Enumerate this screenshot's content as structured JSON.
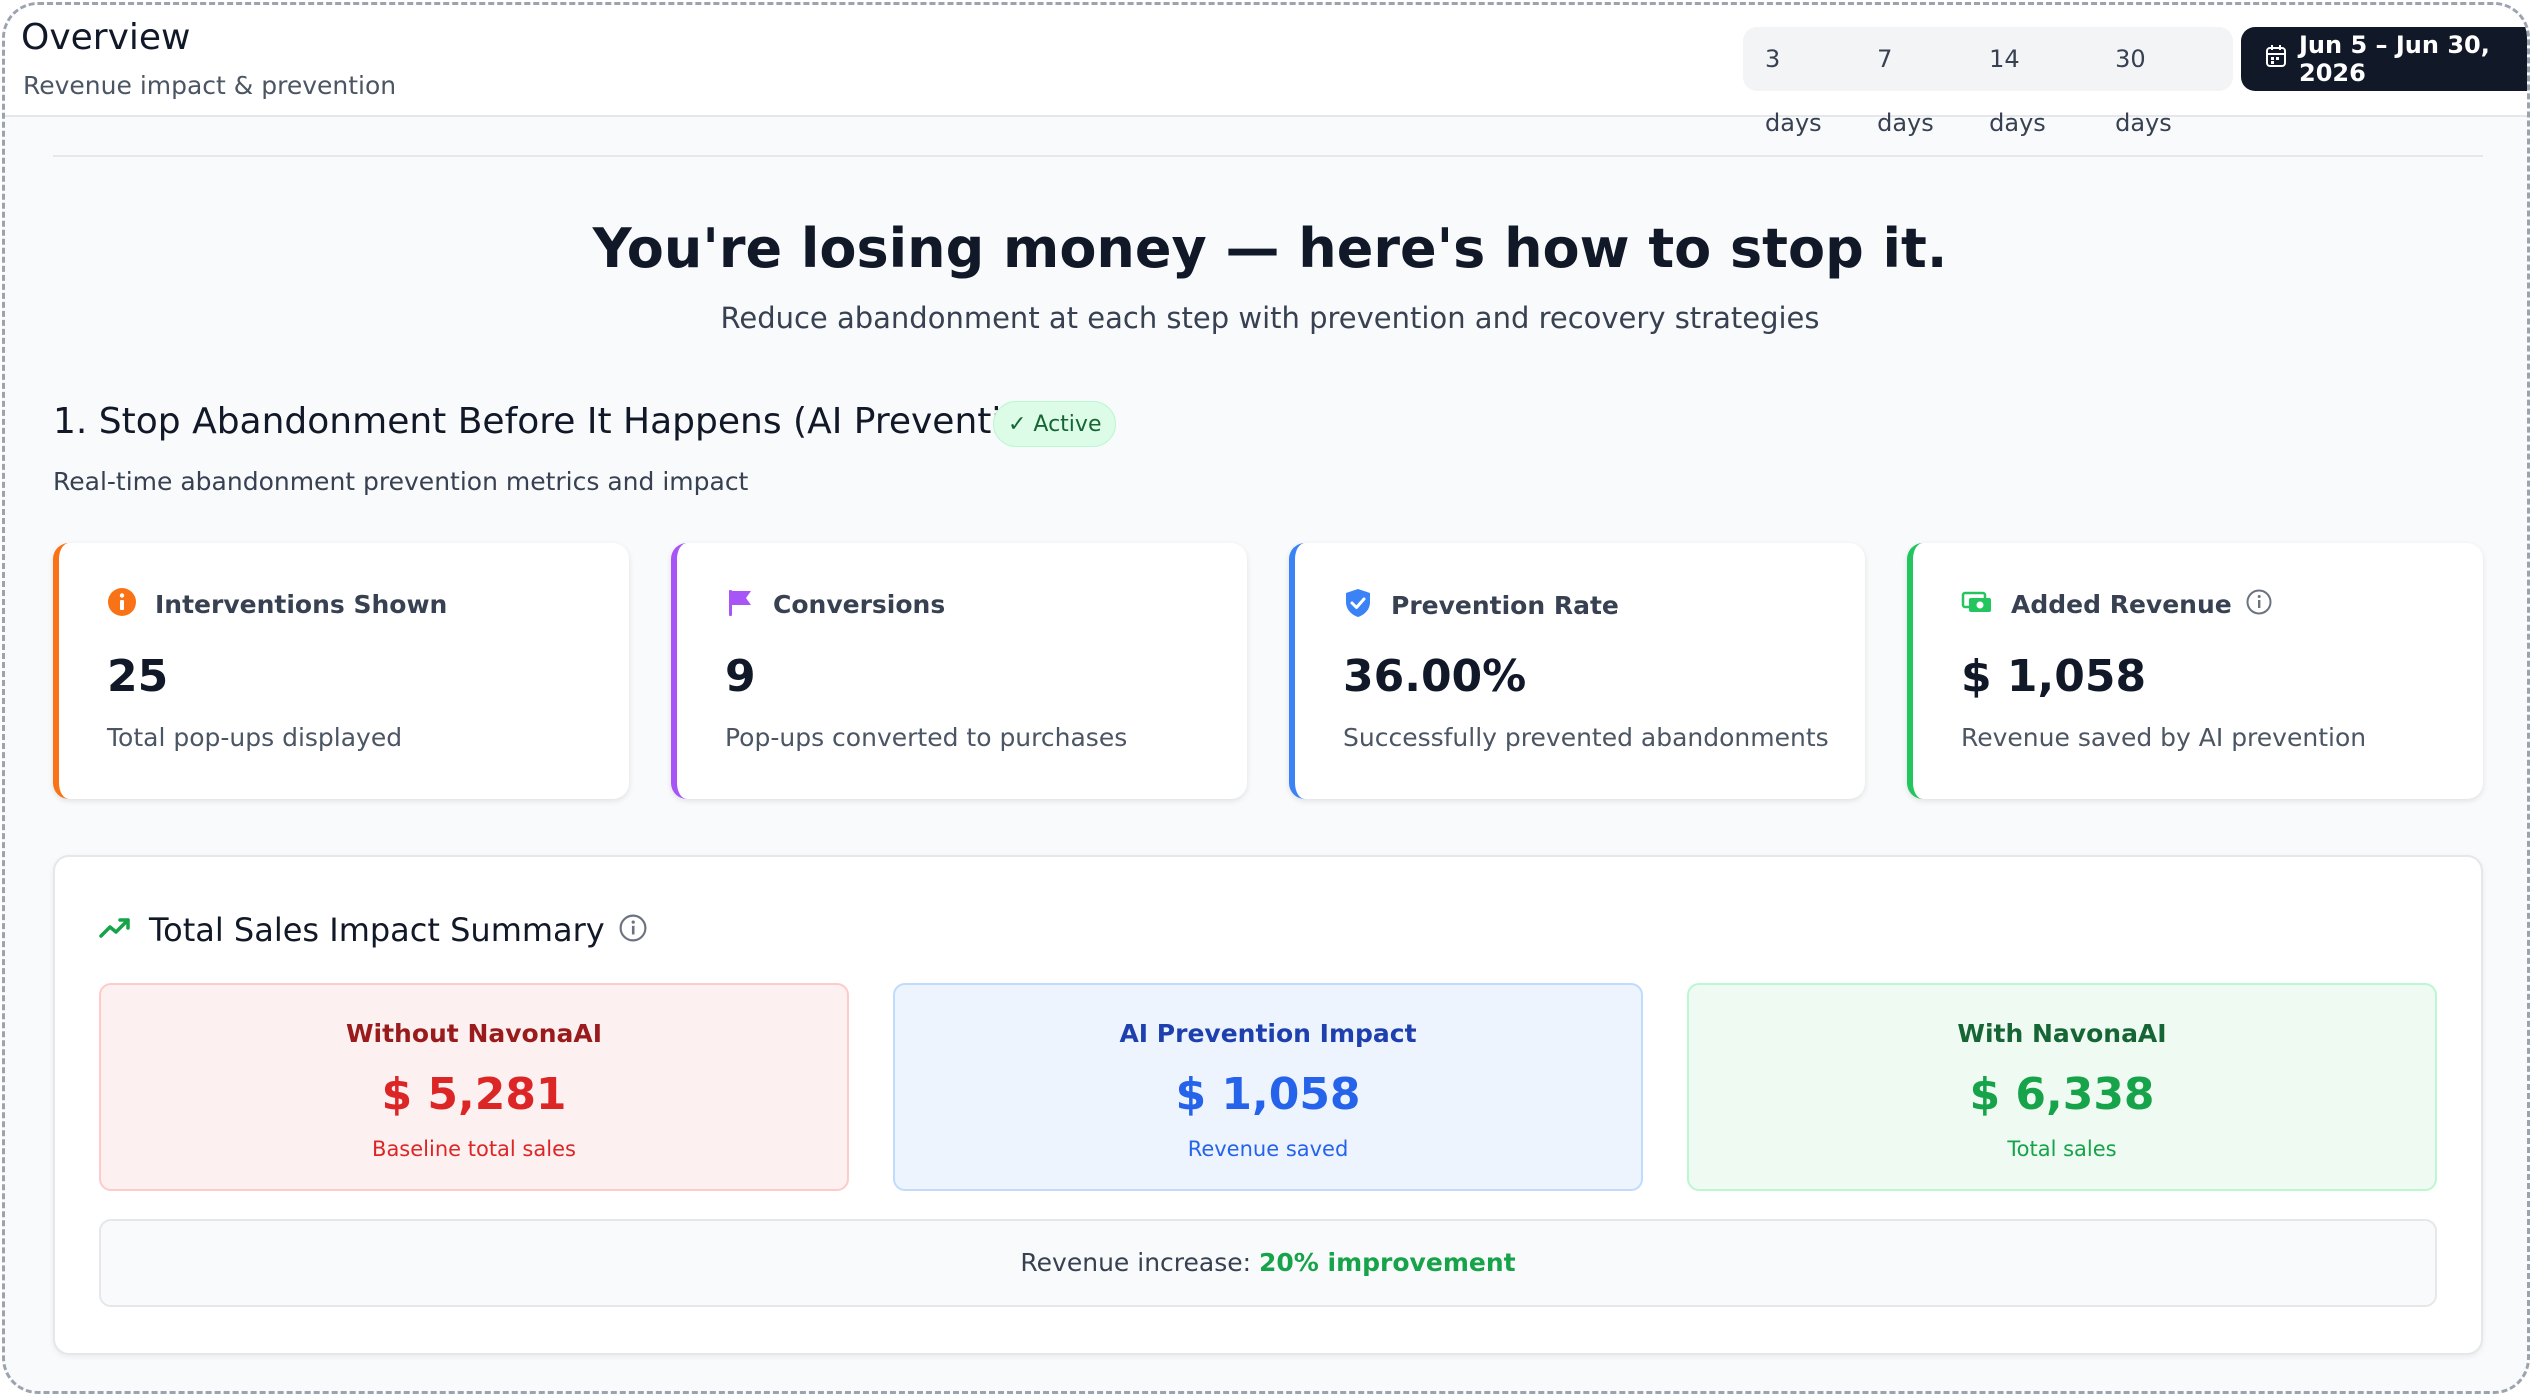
{
  "header": {
    "title": "Overview",
    "subtitle": "Revenue impact & prevention",
    "ranges": [
      "3 days",
      "7 days",
      "14 days",
      "30 days"
    ],
    "date_range": "Jun 5 – Jun 30, 2026",
    "date_icon": "calendar-icon"
  },
  "hero": {
    "title": "You're losing money — here's how to stop it.",
    "subtitle": "Reduce abandonment at each step with prevention and recovery strategies"
  },
  "section": {
    "title": "1. Stop Abandonment Before It Happens (AI Prevention)",
    "badge": "✓ Active",
    "subtitle": "Real-time abandonment prevention metrics and impact"
  },
  "cards": [
    {
      "label": "Interventions Shown",
      "value": "25",
      "desc": "Total pop-ups displayed",
      "icon": "info-icon",
      "accent": "#f97316"
    },
    {
      "label": "Conversions",
      "value": "9",
      "desc": "Pop-ups converted to purchases",
      "icon": "flag-icon",
      "accent": "#a855f7"
    },
    {
      "label": "Prevention Rate",
      "value": "36.00%",
      "desc": "Successfully prevented abandonments",
      "icon": "shield-check-icon",
      "accent": "#3b82f6"
    },
    {
      "label": "Added Revenue",
      "value": "$ 1,058",
      "desc": "Revenue saved by AI prevention",
      "icon": "cash-icon",
      "accent": "#22c55e"
    }
  ],
  "summary": {
    "title": "Total Sales Impact Summary",
    "title_icon": "trending-up-icon",
    "panels": [
      {
        "label": "Without NavonaAI",
        "value": "$ 5,281",
        "desc": "Baseline total sales"
      },
      {
        "label": "AI Prevention Impact",
        "value": "$ 1,058",
        "desc": "Revenue saved"
      },
      {
        "label": "With NavonaAI",
        "value": "$ 6,338",
        "desc": "Total sales"
      }
    ],
    "increase_label": "Revenue increase:",
    "increase_value": "20% improvement"
  }
}
